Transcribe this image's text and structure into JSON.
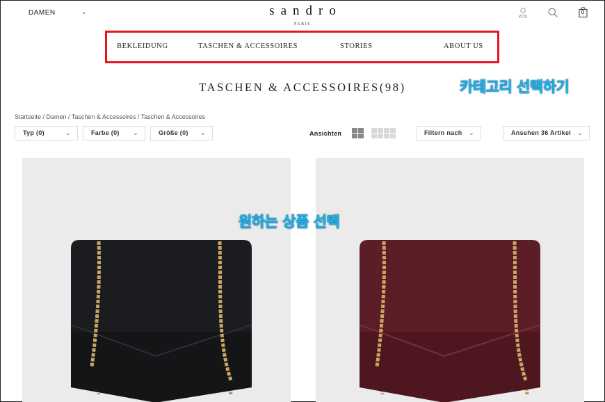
{
  "header": {
    "gender_label": "DAMEN",
    "logo": "sandro",
    "logo_sub": "PARIS",
    "bag_count": "0",
    "icons": [
      "user-icon",
      "search-icon",
      "bag-icon",
      "chevron-down-icon"
    ]
  },
  "nav": {
    "items": [
      "BEKLEIDUNG",
      "TASCHEN & ACCESSOIRES",
      "STORIES",
      "ABOUT US"
    ]
  },
  "page": {
    "title": "TASCHEN & ACCESSOIRES(98)",
    "breadcrumb": "Startseite / Damen / Taschen & Accessoires / Taschen & Accessoires"
  },
  "annotations": {
    "category": "카테고리 선택하기",
    "product": "원하는 상품 선택",
    "highlight_color": "#e8141c",
    "annotation_color": "#1ab2e8"
  },
  "filters": {
    "typ": "Typ (0)",
    "farbe": "Farbe (0)",
    "grosse": "Größe (0)",
    "ansichten": "Ansichten",
    "filtern": "Filtern nach",
    "ansehen": "Ansehen 36 Artikel"
  },
  "products": [
    {
      "color_name": "black",
      "bag_color": "#1b1c1f"
    },
    {
      "color_name": "burgundy",
      "bag_color": "#5c1e26"
    }
  ]
}
